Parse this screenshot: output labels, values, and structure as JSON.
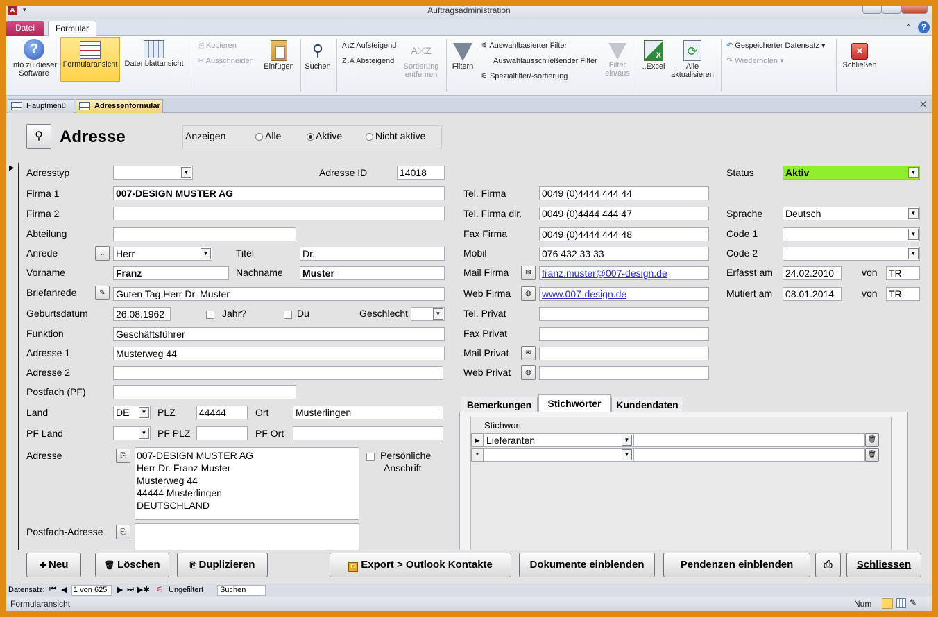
{
  "app": {
    "title": "Auftragsadministration"
  },
  "ribbon_tabs": [
    {
      "label": "Datei"
    },
    {
      "label": "Formular"
    }
  ],
  "ribbon": {
    "info": "Info zu dieser Software",
    "formularansicht": "Formularansicht",
    "datenblattansicht": "Datenblattansicht",
    "kopieren": "Kopieren",
    "ausschneiden": "Ausschneiden",
    "einfuegen": "Einfügen",
    "suchen": "Suchen",
    "aufsteigend": "Aufsteigend",
    "absteigend": "Absteigend",
    "sortierung": "Sortierung entfernen",
    "filtern": "Filtern",
    "auswahlbasiert": "Auswahlbasierter Filter",
    "auswahlausschl": "Auswahlausschließender Filter",
    "spezialfilter": "Spezialfilter/-sortierung",
    "filter_einaus": "Filter ein/aus",
    "excel": "..Excel",
    "alle_akt": "Alle aktualisieren",
    "gespeichert": "Gespeicherter Datensatz",
    "wiederholen": "Wiederholen",
    "schliessen": "Schließen"
  },
  "doc_tabs": [
    {
      "label": "Hauptmenü"
    },
    {
      "label": "Adressenformular"
    }
  ],
  "form": {
    "title": "Adresse",
    "anzeigen": {
      "label": "Anzeigen",
      "options": [
        "Alle",
        "Aktive",
        "Nicht aktive"
      ],
      "selected": "Aktive"
    },
    "adresstyp": {
      "label": "Adresstyp",
      "value": ""
    },
    "adresse_id": {
      "label": "Adresse ID",
      "value": "14018"
    },
    "firma1": {
      "label": "Firma 1",
      "value": "007-DESIGN MUSTER AG"
    },
    "firma2": {
      "label": "Firma 2",
      "value": ""
    },
    "abteilung": {
      "label": "Abteilung",
      "value": ""
    },
    "anrede": {
      "label": "Anrede",
      "value": "Herr",
      "button": ".."
    },
    "titel": {
      "label": "Titel",
      "value": "Dr."
    },
    "vorname": {
      "label": "Vorname",
      "value": "Franz"
    },
    "nachname": {
      "label": "Nachname",
      "value": "Muster"
    },
    "briefanrede": {
      "label": "Briefanrede",
      "value": "Guten Tag Herr Dr. Muster"
    },
    "geburtsdatum": {
      "label": "Geburtsdatum",
      "value": "26.08.1962"
    },
    "jahr": {
      "label": "Jahr?"
    },
    "du": {
      "label": "Du"
    },
    "geschlecht": {
      "label": "Geschlecht",
      "value": ""
    },
    "funktion": {
      "label": "Funktion",
      "value": "Geschäftsführer"
    },
    "adresse1": {
      "label": "Adresse 1",
      "value": "Musterweg 44"
    },
    "adresse2": {
      "label": "Adresse 2",
      "value": ""
    },
    "postfach": {
      "label": "Postfach (PF)",
      "value": ""
    },
    "land": {
      "label": "Land",
      "value": "DE"
    },
    "plz": {
      "label": "PLZ",
      "value": "44444"
    },
    "ort": {
      "label": "Ort",
      "value": "Musterlingen"
    },
    "pf_land": {
      "label": "PF Land",
      "value": ""
    },
    "pf_plz": {
      "label": "PF PLZ",
      "value": ""
    },
    "pf_ort": {
      "label": "PF Ort",
      "value": ""
    },
    "adresse": {
      "label": "Adresse",
      "lines": [
        "007-DESIGN MUSTER AG",
        "Herr Dr. Franz Muster",
        "Musterweg 44",
        "44444 Musterlingen",
        "DEUTSCHLAND"
      ]
    },
    "persoenliche": {
      "label1": "Persönliche",
      "label2": "Anschrift"
    },
    "postfach_adresse": {
      "label": "Postfach-Adresse",
      "value": ""
    },
    "tel_firma": {
      "label": "Tel. Firma",
      "value": "0049 (0)4444 444 44"
    },
    "tel_firma_dir": {
      "label": "Tel. Firma dir.",
      "value": "0049 (0)4444 444 47"
    },
    "fax_firma": {
      "label": "Fax Firma",
      "value": "0049 (0)4444 444 48"
    },
    "mobil": {
      "label": "Mobil",
      "value": "076 432 33 33"
    },
    "mail_firma": {
      "label": "Mail Firma",
      "value": "franz.muster@007-design.de"
    },
    "web_firma": {
      "label": "Web Firma",
      "value": "www.007-design.de"
    },
    "tel_privat": {
      "label": "Tel. Privat",
      "value": ""
    },
    "fax_privat": {
      "label": "Fax Privat",
      "value": ""
    },
    "mail_privat": {
      "label": "Mail Privat",
      "value": ""
    },
    "web_privat": {
      "label": "Web Privat",
      "value": ""
    },
    "status": {
      "label": "Status",
      "value": "Aktiv",
      "color": "#8ef02c"
    },
    "sprache": {
      "label": "Sprache",
      "value": "Deutsch"
    },
    "code1": {
      "label": "Code 1",
      "value": ""
    },
    "code2": {
      "label": "Code 2",
      "value": ""
    },
    "erfasst": {
      "label": "Erfasst am",
      "value": "24.02.2010",
      "von_label": "von",
      "von": "TR"
    },
    "mutiert": {
      "label": "Mutiert am",
      "value": "08.01.2014",
      "von_label": "von",
      "von": "TR"
    },
    "subtabs": [
      {
        "label": "Bemerkungen"
      },
      {
        "label": "Stichwörter"
      },
      {
        "label": "Kundendaten"
      }
    ],
    "stichwort": {
      "header": "Stichwort",
      "rows": [
        {
          "value": "Lieferanten"
        },
        {
          "value": ""
        }
      ]
    }
  },
  "buttons": {
    "neu": "Neu",
    "loeschen": "Löschen",
    "duplizieren": "Duplizieren",
    "export": "Export > Outlook Kontakte",
    "dokumente": "Dokumente einblenden",
    "pendenzen": "Pendenzen einblenden",
    "schliessen": "Schliessen"
  },
  "navbar": {
    "label": "Datensatz:",
    "record": "1 von 625",
    "filter": "Ungefiltert",
    "search": "Suchen"
  },
  "statusbar": {
    "left": "Formularansicht",
    "right": "Num"
  }
}
